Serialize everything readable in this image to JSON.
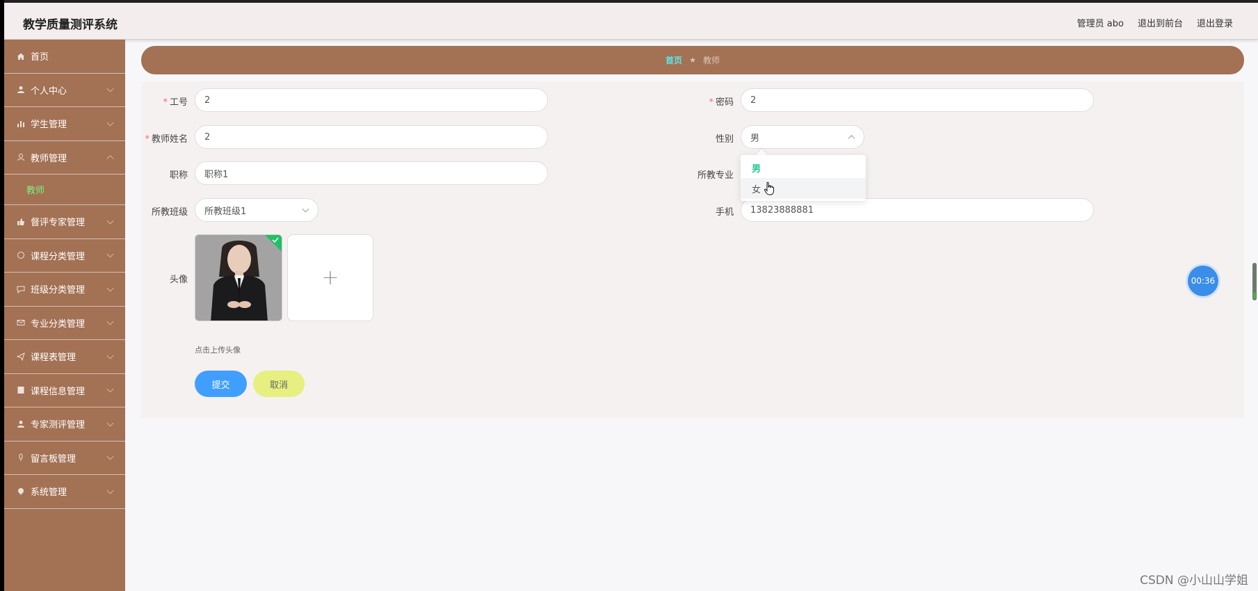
{
  "app_title": "教学质量测评系统",
  "header": {
    "user_label": "管理员 abo",
    "front_link": "退出到前台",
    "logout_link": "退出登录"
  },
  "sidebar": {
    "items": [
      {
        "label": "首页",
        "icon": "home-icon"
      },
      {
        "label": "个人中心",
        "icon": "user-icon"
      },
      {
        "label": "学生管理",
        "icon": "bar-chart-icon"
      },
      {
        "label": "教师管理",
        "icon": "user-outline-icon"
      },
      {
        "label": "督评专家管理",
        "icon": "thumb-icon"
      },
      {
        "label": "课程分类管理",
        "icon": "refresh-icon"
      },
      {
        "label": "班级分类管理",
        "icon": "chat-icon"
      },
      {
        "label": "专业分类管理",
        "icon": "mail-icon"
      },
      {
        "label": "课程表管理",
        "icon": "send-icon"
      },
      {
        "label": "课程信息管理",
        "icon": "doc-icon"
      },
      {
        "label": "专家测评管理",
        "icon": "person-icon"
      },
      {
        "label": "留言板管理",
        "icon": "mic-icon"
      },
      {
        "label": "系统管理",
        "icon": "pin-icon"
      }
    ],
    "active_sub": "教师"
  },
  "breadcrumb": {
    "home": "首页",
    "separator": "★",
    "current": "教师"
  },
  "form": {
    "id_label": "工号",
    "id_value": "2",
    "password_label": "密码",
    "password_value": "2",
    "name_label": "教师姓名",
    "name_value": "2",
    "gender_label": "性别",
    "gender_value": "男",
    "gender_options": [
      "男",
      "女"
    ],
    "title_label": "职称",
    "title_value": "职称1",
    "major_label": "所教专业",
    "class_label": "所教班级",
    "class_value": "所教班级1",
    "phone_label": "手机",
    "phone_value": "13823888881",
    "avatar_label": "头像",
    "upload_plus": "+",
    "upload_hint": "点击上传头像",
    "submit": "提交",
    "cancel": "取消"
  },
  "timer": "00:36",
  "watermark": "CSDN @小山山学姐",
  "colors": {
    "sidebar": "#a37154",
    "header": "#f3eded",
    "submit": "#409eff",
    "cancel": "#e6ef80",
    "active_sub": "#7ef07e",
    "crumb_home": "#5fe6ea"
  }
}
